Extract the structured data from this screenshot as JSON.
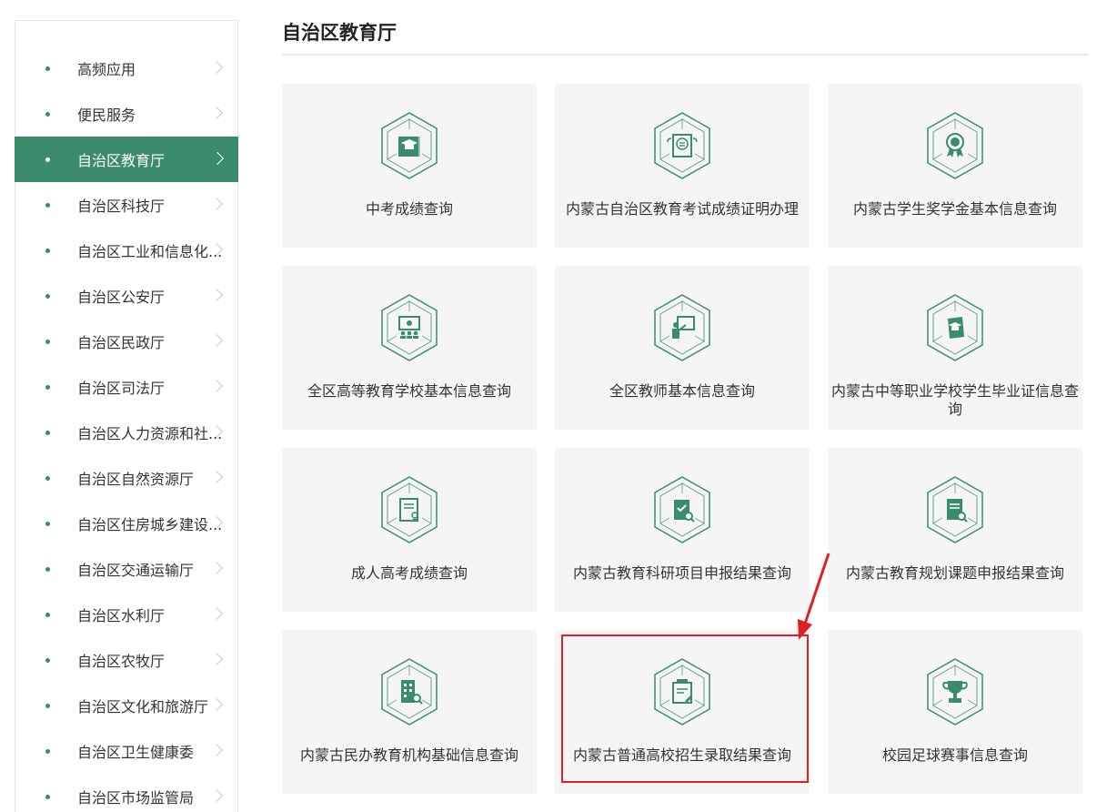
{
  "sidebar": {
    "items": [
      {
        "label": "高频应用"
      },
      {
        "label": "便民服务"
      },
      {
        "label": "自治区教育厅"
      },
      {
        "label": "自治区科技厅"
      },
      {
        "label": "自治区工业和信息化..."
      },
      {
        "label": "自治区公安厅"
      },
      {
        "label": "自治区民政厅"
      },
      {
        "label": "自治区司法厅"
      },
      {
        "label": "自治区人力资源和社..."
      },
      {
        "label": "自治区自然资源厅"
      },
      {
        "label": "自治区住房城乡建设..."
      },
      {
        "label": "自治区交通运输厅"
      },
      {
        "label": "自治区水利厅"
      },
      {
        "label": "自治区农牧厅"
      },
      {
        "label": "自治区文化和旅游厅"
      },
      {
        "label": "自治区卫生健康委"
      },
      {
        "label": "自治区市场监管局"
      }
    ],
    "active_index": 2
  },
  "main": {
    "title": "自治区教育厅",
    "cards": [
      {
        "title": "中考成绩查询",
        "icon": "graduation-book-icon"
      },
      {
        "title": "内蒙古自治区教育考试成绩证明办理",
        "icon": "certificate-icon"
      },
      {
        "title": "内蒙古学生奖学金基本信息查询",
        "icon": "medal-icon"
      },
      {
        "title": "全区高等教育学校基本信息查询",
        "icon": "classroom-icon"
      },
      {
        "title": "全区教师基本信息查询",
        "icon": "teacher-icon"
      },
      {
        "title": "内蒙古中等职业学校学生毕业证信息查询",
        "icon": "diploma-icon"
      },
      {
        "title": "成人高考成绩查询",
        "icon": "exam-paper-icon"
      },
      {
        "title": "内蒙古教育科研项目申报结果查询",
        "icon": "research-search-icon"
      },
      {
        "title": "内蒙古教育规划课题申报结果查询",
        "icon": "document-search-icon"
      },
      {
        "title": "内蒙古民办教育机构基础信息查询",
        "icon": "building-search-icon"
      },
      {
        "title": "内蒙古普通高校招生录取结果查询",
        "icon": "admission-icon"
      },
      {
        "title": "校园足球赛事信息查询",
        "icon": "trophy-icon"
      }
    ]
  },
  "colors": {
    "accent": "#3a8c6b",
    "card_bg": "#f5f5f5",
    "highlight": "#e02020"
  }
}
